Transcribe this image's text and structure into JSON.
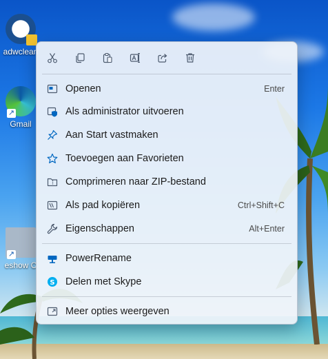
{
  "desktop": {
    "icons": [
      {
        "label": "adwclean"
      },
      {
        "label": "Gmail"
      },
      {
        "label": "eshow C"
      }
    ]
  },
  "context_menu": {
    "toolbar": [
      {
        "icon": "cut-icon"
      },
      {
        "icon": "copy-icon"
      },
      {
        "icon": "paste-icon"
      },
      {
        "icon": "rename-icon"
      },
      {
        "icon": "share-icon"
      },
      {
        "icon": "delete-icon"
      }
    ],
    "items": [
      {
        "label": "Openen",
        "shortcut": "Enter",
        "icon": "open-icon"
      },
      {
        "label": "Als administrator uitvoeren",
        "shortcut": "",
        "icon": "admin-shield-icon"
      },
      {
        "label": "Aan Start vastmaken",
        "shortcut": "",
        "icon": "pin-icon"
      },
      {
        "label": "Toevoegen aan Favorieten",
        "shortcut": "",
        "icon": "star-icon"
      },
      {
        "label": "Comprimeren naar ZIP-bestand",
        "shortcut": "",
        "icon": "zip-folder-icon"
      },
      {
        "label": "Als pad kopiëren",
        "shortcut": "Ctrl+Shift+C",
        "icon": "copy-path-icon"
      },
      {
        "label": "Eigenschappen",
        "shortcut": "Alt+Enter",
        "icon": "wrench-icon"
      },
      {
        "label": "PowerRename",
        "shortcut": "",
        "icon": "powerrename-icon"
      },
      {
        "label": "Delen met Skype",
        "shortcut": "",
        "icon": "skype-icon"
      },
      {
        "label": "Meer opties weergeven",
        "shortcut": "",
        "icon": "more-options-icon"
      }
    ]
  },
  "colors": {
    "accent": "#0067c0",
    "icon_gray": "#4c5a6e",
    "skype": "#00aff0"
  }
}
